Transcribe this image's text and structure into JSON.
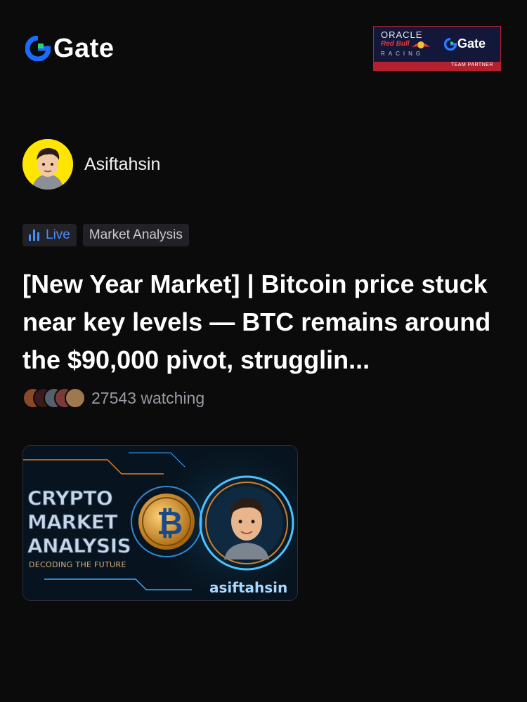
{
  "brand": {
    "name": "Gate",
    "logo_icon": "gate-logo-icon"
  },
  "partner_badge": {
    "oracle": "ORACLE",
    "redbull": "Red Bull",
    "racing": "RACING",
    "gate": "Gate",
    "strip": "TEAM PARTNER"
  },
  "post": {
    "author": "Asiftahsin",
    "tags": {
      "live": "Live",
      "category": "Market Analysis"
    },
    "title": "[New Year Market] | Bitcoin price stuck near key levels — BTC remains around the $90,000 pivot, strugglin...",
    "watching": "27543 watching",
    "thumbnail": {
      "line1": "CRYPTO",
      "line2": "MARKET",
      "line3": "ANALYSIS",
      "subtitle": "DECODING THE FUTURE",
      "handle": "asiftahsin"
    }
  },
  "colors": {
    "background": "#0b0b0c",
    "accent": "#4a8dff",
    "avatar_bg": "#ffe600",
    "partner_red": "#b32030"
  }
}
